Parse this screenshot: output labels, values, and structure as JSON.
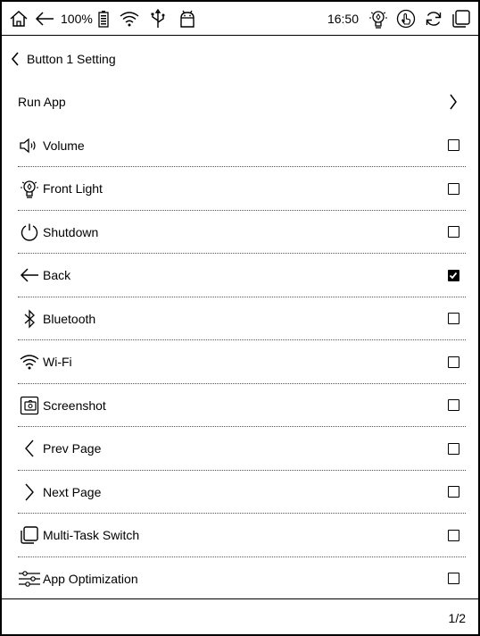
{
  "status_bar": {
    "battery_percent": "100%",
    "time": "16:50",
    "icons_left": [
      "home-icon",
      "back-arrow-icon",
      "battery-icon",
      "wifi-icon",
      "usb-icon",
      "android-icon"
    ],
    "icons_right": [
      "front-light-icon",
      "touch-icon",
      "refresh-icon",
      "multitask-icon"
    ]
  },
  "header": {
    "title": "Button 1 Setting"
  },
  "list": {
    "run_app": {
      "label": "Run App"
    },
    "items": [
      {
        "label": "Volume",
        "icon": "volume-icon",
        "checked": false
      },
      {
        "label": "Front Light",
        "icon": "front-light-icon",
        "checked": false
      },
      {
        "label": "Shutdown",
        "icon": "power-icon",
        "checked": false
      },
      {
        "label": "Back",
        "icon": "back-arrow-icon",
        "checked": true
      },
      {
        "label": "Bluetooth",
        "icon": "bluetooth-icon",
        "checked": false
      },
      {
        "label": "Wi-Fi",
        "icon": "wifi-icon",
        "checked": false
      },
      {
        "label": "Screenshot",
        "icon": "screenshot-icon",
        "checked": false
      },
      {
        "label": "Prev Page",
        "icon": "chevron-left-icon",
        "checked": false
      },
      {
        "label": "Next Page",
        "icon": "chevron-right-icon",
        "checked": false
      },
      {
        "label": "Multi-Task Switch",
        "icon": "multitask-icon",
        "checked": false
      },
      {
        "label": "App Optimization",
        "icon": "sliders-icon",
        "checked": false
      }
    ]
  },
  "footer": {
    "page_indicator": "1/2"
  }
}
